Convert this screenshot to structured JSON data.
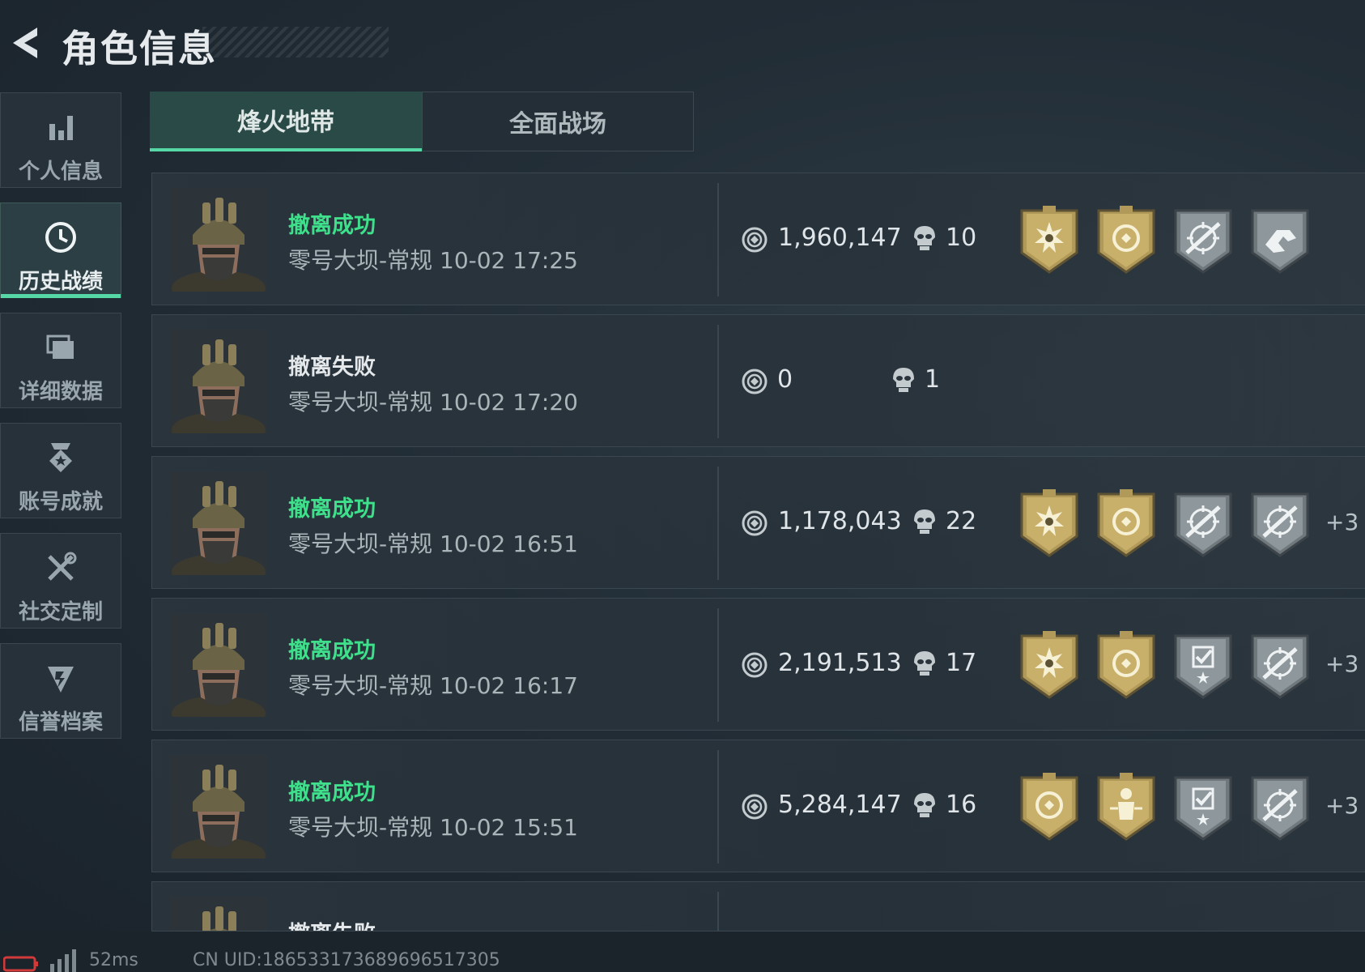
{
  "header": {
    "title": "角色信息"
  },
  "sidebar": {
    "items": [
      {
        "label": "个人信息",
        "icon": "bar-chart-icon",
        "active": false
      },
      {
        "label": "历史战绩",
        "icon": "clock-icon",
        "active": true
      },
      {
        "label": "详细数据",
        "icon": "stacked-cards-icon",
        "active": false
      },
      {
        "label": "账号成就",
        "icon": "medal-icon",
        "active": false
      },
      {
        "label": "社交定制",
        "icon": "tools-icon",
        "active": false
      },
      {
        "label": "信誉档案",
        "icon": "shield-badge-icon",
        "active": false
      }
    ]
  },
  "tabs": [
    {
      "label": "烽火地带",
      "active": true
    },
    {
      "label": "全面战场",
      "active": false
    }
  ],
  "colors": {
    "success": "#3fe08c",
    "accent": "#56d8a6",
    "gold": "#c9b06a",
    "silver": "#8e979c"
  },
  "records": [
    {
      "status": "撤离成功",
      "result": "success",
      "map_time": "零号大坝-常规 10-02 17:25",
      "value": "1,960,147",
      "kills": "10",
      "badges": [
        "gold-sunburst-badge",
        "gold-coin-badge",
        "silver-crosshair-badge",
        "silver-runner-badge"
      ],
      "more": ""
    },
    {
      "status": "撤离失败",
      "result": "fail",
      "map_time": "零号大坝-常规 10-02 17:20",
      "value": "0",
      "kills": "1",
      "badges": [],
      "more": ""
    },
    {
      "status": "撤离成功",
      "result": "success",
      "map_time": "零号大坝-常规 10-02 16:51",
      "value": "1,178,043",
      "kills": "22",
      "badges": [
        "gold-sunburst-badge",
        "gold-coin-badge",
        "silver-crosshair-badge",
        "silver-crosshair-badge"
      ],
      "more": "+3"
    },
    {
      "status": "撤离成功",
      "result": "success",
      "map_time": "零号大坝-常规 10-02 16:17",
      "value": "2,191,513",
      "kills": "17",
      "badges": [
        "gold-sunburst-badge",
        "gold-coin-badge",
        "silver-checklist-badge",
        "silver-crosshair-badge"
      ],
      "more": "+3"
    },
    {
      "status": "撤离成功",
      "result": "success",
      "map_time": "零号大坝-常规 10-02 15:51",
      "value": "5,284,147",
      "kills": "16",
      "badges": [
        "gold-coin-badge",
        "gold-figure-badge",
        "silver-checklist-badge",
        "silver-crosshair-badge"
      ],
      "more": "+3"
    },
    {
      "status": "撤离失败",
      "result": "fail",
      "map_time": "",
      "value": "",
      "kills": "",
      "badges": [],
      "more": ""
    }
  ],
  "footer": {
    "ping": "52ms",
    "uid": "CN UID:1865331736896965173​05"
  }
}
